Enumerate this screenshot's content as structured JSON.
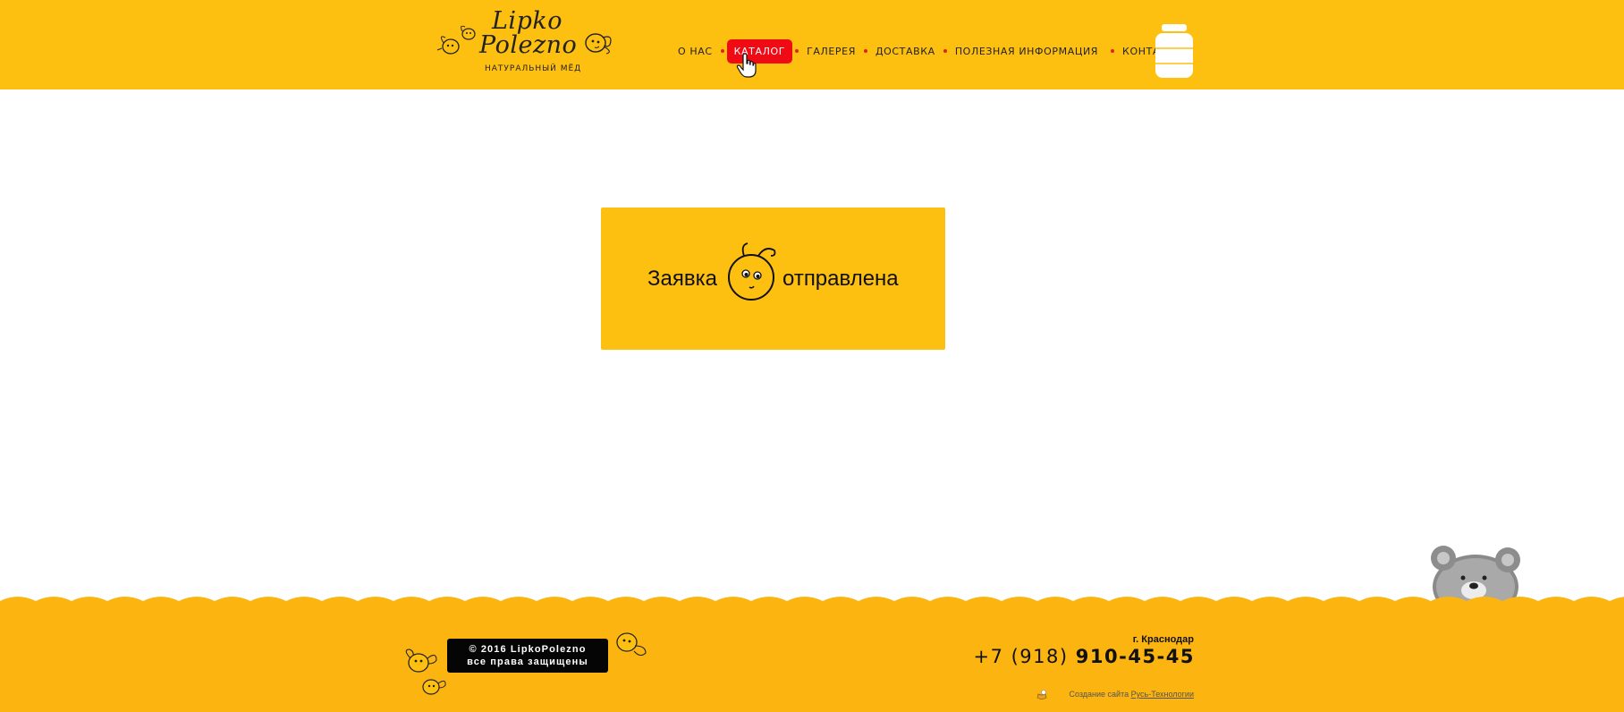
{
  "header": {
    "logo": {
      "line1": "Lipko",
      "line2": "Polezno",
      "subtitle": "НАТУРАЛЬНЫЙ МЁД"
    },
    "nav": [
      {
        "label": "О НАС"
      },
      {
        "label": "КАТАЛОГ",
        "active": true
      },
      {
        "label": "ГАЛЕРЕЯ"
      },
      {
        "label": "ДОСТАВКА"
      },
      {
        "label": "ПОЛЕЗНАЯ ИНФОРМАЦИЯ"
      },
      {
        "label": "КОНТАКТЫ"
      }
    ],
    "jar_icon": "honey-jar-icon"
  },
  "main": {
    "message_part1": "Заявка",
    "message_part2": "отправлена",
    "icon": "bee-face-icon"
  },
  "footer": {
    "copyright_line1": "© 2016 LipkoPolezno",
    "copyright_line2": "все права защищены",
    "city": "г. Краснодар",
    "phone_code": "+7 (918)",
    "phone_number": "910-45-45",
    "credit_prefix": "Создание сайта",
    "credit_link": "Русь-Технологии"
  },
  "colors": {
    "brand_yellow": "#FDBF10",
    "footer_yellow": "#FCB410",
    "active_red": "#F00A14",
    "nav_dot": "#E2201A",
    "text_dark": "#222222"
  }
}
